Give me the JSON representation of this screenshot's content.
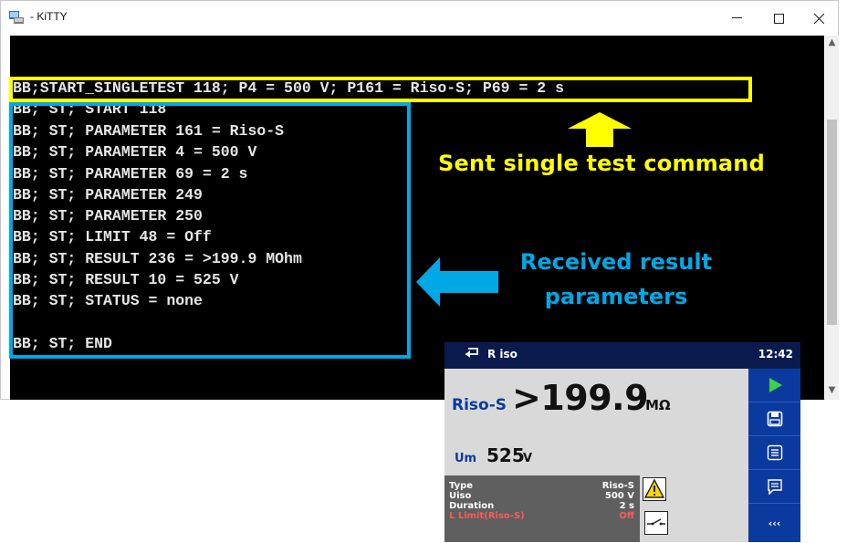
{
  "window": {
    "title": "- KiTTY"
  },
  "terminal": {
    "lines": [
      "BB;START_SINGLETEST 118; P4 = 500 V; P161 = Riso-S; P69 = 2 s",
      "BB; ST; START 118",
      "BB; ST; PARAMETER 161 = Riso-S",
      "BB; ST; PARAMETER 4 = 500 V",
      "BB; ST; PARAMETER 69 = 2 s",
      "BB; ST; PARAMETER 249",
      "BB; ST; PARAMETER 250",
      "BB; ST; LIMIT 48 = Off",
      "BB; ST; RESULT 236 = >199.9 MOhm",
      "BB; ST; RESULT 10 = 525 V",
      "BB; ST; STATUS = none",
      "",
      "BB; ST; END"
    ]
  },
  "annotations": {
    "sent_label": "Sent single test command",
    "received_label_line1": "Received result",
    "received_label_line2": "parameters",
    "yellow": "#ffff00",
    "blue": "#00a8e6"
  },
  "instrument": {
    "title": "R iso",
    "time": "12:42",
    "main_label": "Riso-S",
    "main_value": ">199.9",
    "main_unit": "MΩ",
    "um_label": "Um",
    "um_value": "525",
    "um_unit": "V",
    "info": [
      {
        "key": "Type",
        "value": "Riso-S"
      },
      {
        "key": "Uiso",
        "value": "500 V"
      },
      {
        "key": "Duration",
        "value": "2 s"
      },
      {
        "key": "L Limit(Riso-S)",
        "value": "Off"
      }
    ],
    "side_buttons": [
      "play-icon",
      "save-icon",
      "list-icon",
      "comment-icon",
      "more-icon"
    ],
    "more_label": "‹‹‹"
  }
}
